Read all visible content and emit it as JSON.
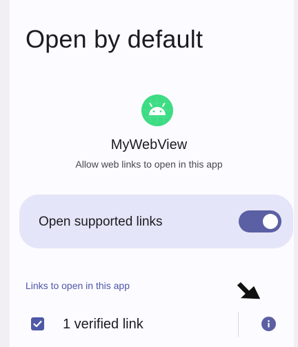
{
  "page": {
    "title": "Open by default"
  },
  "app": {
    "name": "MyWebView",
    "description": "Allow web links to open in this app",
    "icon": "android-app-icon",
    "icon_color": "#3ddc84"
  },
  "toggle": {
    "label": "Open supported links",
    "state": "on",
    "accent_color": "#5b5fa3",
    "card_color": "#e4e5f8"
  },
  "links_section": {
    "header": "Links to open in this app",
    "header_color": "#4c55a8",
    "items": [
      {
        "label": "1 verified link",
        "checked": true,
        "info_icon": "info-icon"
      }
    ]
  },
  "cursor": {
    "icon": "mouse-pointer-icon"
  }
}
